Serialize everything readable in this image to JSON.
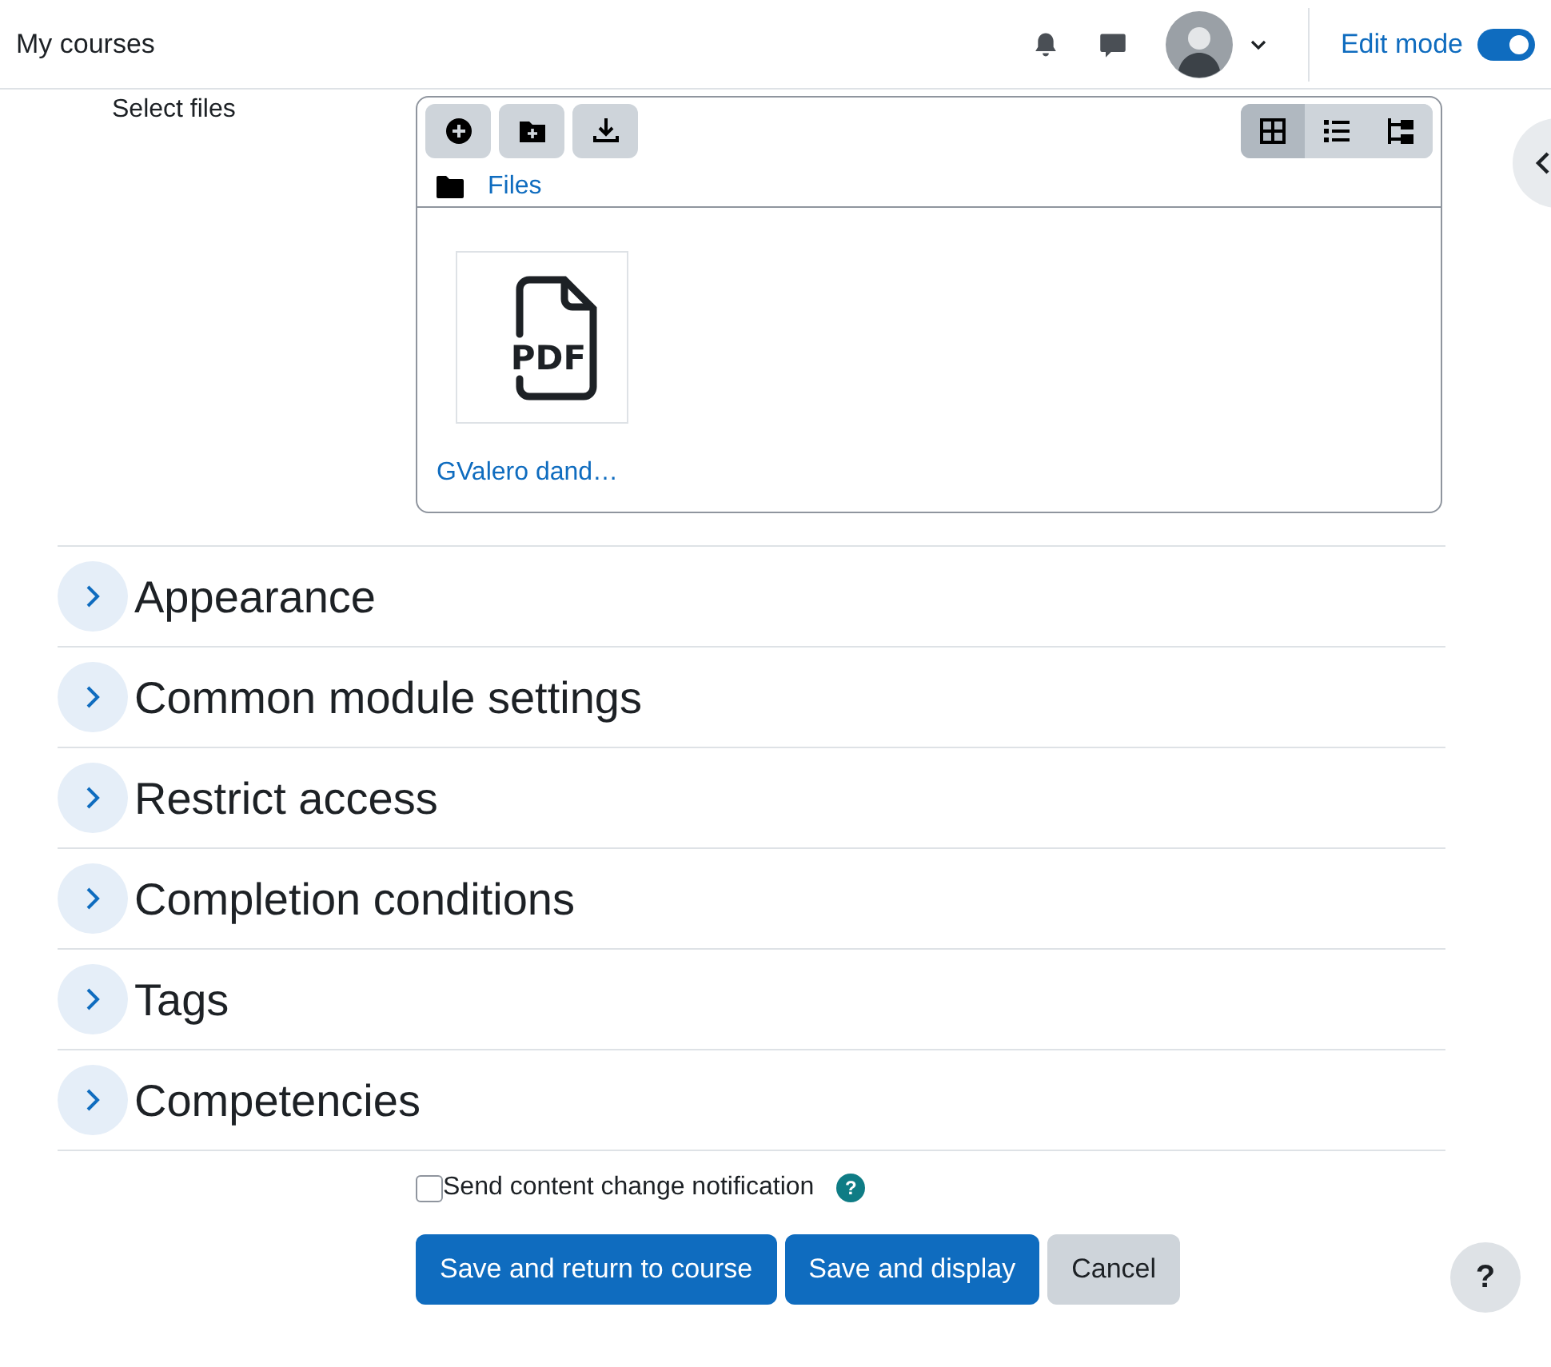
{
  "header": {
    "title": "My courses",
    "edit_mode": {
      "label": "Edit mode",
      "on": true
    }
  },
  "file_field": {
    "label": "Select files",
    "path": "Files",
    "view_modes": [
      {
        "kind": "icons",
        "selected": true
      },
      {
        "kind": "list",
        "selected": false
      },
      {
        "kind": "tree",
        "selected": false
      }
    ],
    "files": [
      {
        "name": "GValero dand…",
        "icon_text": "PDF"
      }
    ]
  },
  "sections": [
    {
      "title": "Appearance",
      "expanded": false
    },
    {
      "title": "Common module settings",
      "expanded": false
    },
    {
      "title": "Restrict access",
      "expanded": false
    },
    {
      "title": "Completion conditions",
      "expanded": false
    },
    {
      "title": "Tags",
      "expanded": false
    },
    {
      "title": "Competencies",
      "expanded": false
    }
  ],
  "notification": {
    "label": "Send content change notification",
    "checked": false,
    "help": "?"
  },
  "buttons": [
    {
      "label": "Save and return to course",
      "kind": "primary"
    },
    {
      "label": "Save and display",
      "kind": "primary"
    },
    {
      "label": "Cancel",
      "kind": "secondary"
    }
  ],
  "help_button": "?"
}
